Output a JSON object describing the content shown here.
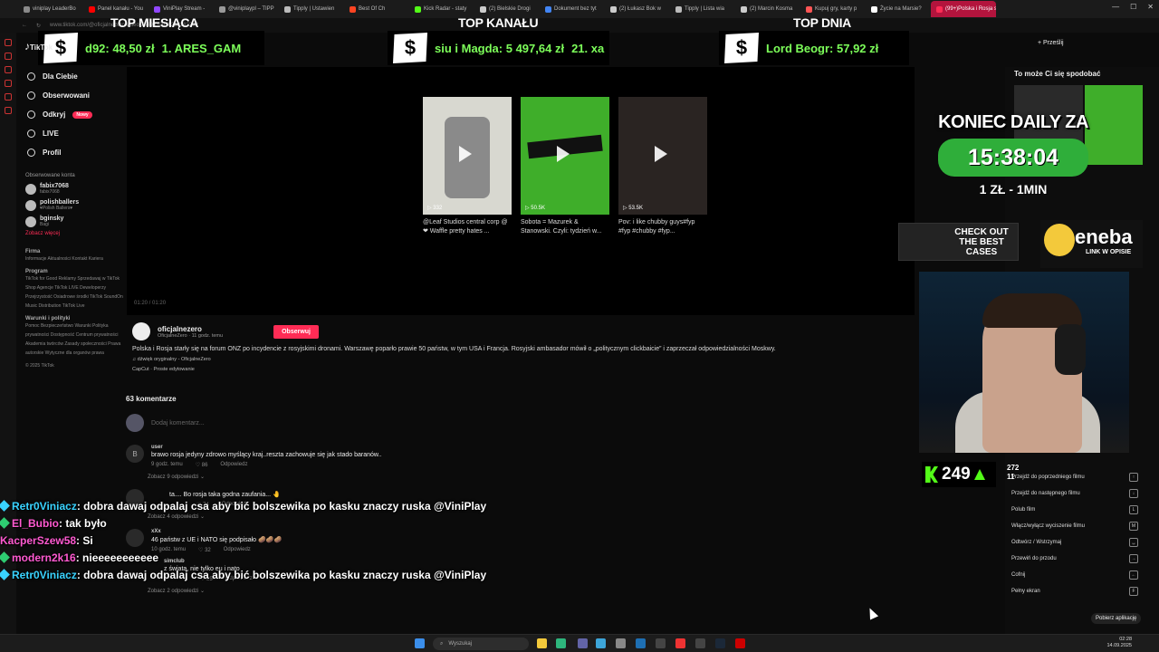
{
  "browser": {
    "tabs": [
      {
        "label": "viniplay LeaderBo",
        "color": "#8a8a8a"
      },
      {
        "label": "Panel kanału - You",
        "color": "#ff0000"
      },
      {
        "label": "ViniPlay Stream -",
        "color": "#9147ff"
      },
      {
        "label": "@viniplaypl – TIPP",
        "color": "#999999"
      },
      {
        "label": "Tipply | Ustawien",
        "color": "#bbbbbb"
      },
      {
        "label": "Best Of Ch",
        "color": "#ff4422"
      },
      {
        "label": "Kick Radar - staty",
        "color": "#53fc18"
      },
      {
        "label": "(2) Bielskie Drogi",
        "color": "#cccccc"
      },
      {
        "label": "Dokument bez tyt",
        "color": "#4285f4"
      },
      {
        "label": "(2) Łukasz Bok w",
        "color": "#cccccc"
      },
      {
        "label": "Tipply | Lista wia",
        "color": "#bbbbbb"
      },
      {
        "label": "(2) Marcin Kosma",
        "color": "#cccccc"
      },
      {
        "label": "Kupuj gry, karty p",
        "color": "#f55"
      },
      {
        "label": "Życie na Marsie?",
        "color": "#ffffff"
      },
      {
        "label": "(99+)Polska i Rosja starły",
        "color": "#fe2c55"
      }
    ],
    "url": "www.tiktok.com/@oficjalnezero/video/7549530976218282282"
  },
  "banners": [
    {
      "title": "TOP MIESIĄCA",
      "text": "d92: 48,50 zł",
      "text2": "1. ARES_GAM"
    },
    {
      "title": "TOP KANAŁU",
      "text": "siu i Magda: 5 497,64 zł",
      "text2": "21. xa"
    },
    {
      "title": "TOP DNIA",
      "text": "Lord Beogr: 57,92 zł",
      "text2": ""
    }
  ],
  "dollar": "$",
  "tiktok": {
    "logo": "TikTok",
    "nav": [
      "Dla Ciebie",
      "Obserwowani",
      "Odkryj",
      "LIVE",
      "Profil"
    ],
    "new_badge": "Nowy",
    "followed_header": "Obserwowane konta",
    "followed": [
      {
        "name": "fabix7068",
        "sub": "fabix7068"
      },
      {
        "name": "polishballers",
        "sub": "♥Polish Ballers♥"
      },
      {
        "name": "bginsky",
        "sub": "Bagi"
      }
    ],
    "see_more": "Zobacz więcej",
    "footer_company": "Firma",
    "footer_company_links": "Informacje  Aktualności  Kontakt  Kariera",
    "footer_program": "Program",
    "footer_program_links": "TikTok for Good  Reklamy  Sprzedawaj w TikTok Shop  Agencje TikTok LIVE  Deweloperzy  Przejrzystość  Osiadrowe środki TikTok  SoundOn Music Distribution  TikTok Live",
    "footer_terms": "Warunki i polityki",
    "footer_terms_links": "Pomoc  Bezpieczeństwo  Warunki  Polityka prywatności  Dostępność  Centrum prywatności  Akademia twórców  Zasady społeczności  Prawa autorskie  Wytyczne dla organów prawa",
    "copyright": "© 2025 TikTok"
  },
  "videos": [
    {
      "views": "▷ 332",
      "caption": "@Leaf Studios central corp @❤ Waffle pretty hates ...",
      "bg": "#d8d8d0"
    },
    {
      "views": "▷ 50.5K",
      "caption": "Sobota = Mazurek & Stanowski. Czyli: tydzień w...",
      "bg": "#3fae2a"
    },
    {
      "views": "▷ 53.5K",
      "caption": "Pov: i like chubby guys#fyp #fyp #chubby #fyp...",
      "bg": "#2a2422"
    }
  ],
  "time_display": "01:20 / 01:20",
  "post": {
    "author": "oficjalnezero",
    "author_sub": "OficjalneZero · 11 godz. temu",
    "follow": "Obserwuj",
    "description": "Polska i Rosja starły się na forum ONZ po incydencie z rosyjskimi dronami. Warszawę poparło prawie 50 państw, w tym USA i Francja. Rosyjski ambasador mówił o „politycznym clickbaicie” i zaprzeczał odpowiedzialności Moskwy.",
    "sound": "♫ dźwięk oryginalny - OficjalneZero",
    "capcut": "CapCut · Proste edytowanie"
  },
  "comments": {
    "count": "63 komentarze",
    "placeholder": "Dodaj komentarz...",
    "reply_label": "Odpowiedz",
    "items": [
      {
        "avatar": "B",
        "user": "user",
        "text": "brawo rosja jedyny zdrowo myślący kraj..reszta zachowuje się jak stado baranów..",
        "time": "9 godz. temu",
        "likes": "♡ 86",
        "more": "Zobacz 9 odpowiedzi ⌄"
      },
      {
        "avatar": "",
        "user": "",
        "text": "ta.... Bo rosja taka godna zaufania... 🤚",
        "time": "",
        "likes": "♡ 74",
        "more": "Zobacz 4 odpowiedzi ⌄"
      },
      {
        "avatar": "",
        "user": "xXx",
        "text": "46 państw z UE i NATO się podpisało 🥔🥔🥔",
        "time": "10 godz. temu",
        "likes": "♡ 32",
        "more": ""
      },
      {
        "avatar": "",
        "user": "simclub",
        "text": "z świata, nie tylko eu i nato",
        "time": "",
        "likes": "♡ 85",
        "more": "Zobacz 2 odpowiedzi ⌄"
      }
    ]
  },
  "chat": [
    {
      "user": "Retr0Viniacz",
      "color": "#39d3ff",
      "msg": ": dobra dawaj odpalaj csa aby bić bolszewika po kasku znaczy ruska @ViniPlay"
    },
    {
      "user": "El_Bubio",
      "color": "#ff5ad1",
      "msg": ": tak było"
    },
    {
      "user": "KacperSzew58",
      "color": "#ff5ad1",
      "msg": ": Si"
    },
    {
      "user": "modern2k16",
      "color": "#ff5ad1",
      "msg": ": nieeeeeeeeeee"
    },
    {
      "user": "Retr0Viniacz",
      "color": "#39d3ff",
      "msg": ": dobra dawaj odpalaj csa aby bić bolszewika po kasku znaczy ruska @ViniPlay"
    }
  ],
  "right": {
    "upload": "+ Prześlij",
    "suggest_title": "To może Ci się spodobać",
    "daily_title": "KONIEC DAILY ZA",
    "daily_timer": "15:38:04",
    "daily_sub": "1 ZŁ - 1MIN",
    "ad1": "CHECK OUT THE BEST CASES",
    "ad2": "eneba",
    "ad2_sub": "LINK W OPISIE",
    "counter": "249",
    "stats1": "272",
    "stats2": "11",
    "shortcuts": [
      {
        "label": "Przejdź do poprzedniego filmu",
        "key": "↑"
      },
      {
        "label": "Przejdź do następnego filmu",
        "key": "↓"
      },
      {
        "label": "Polub film",
        "key": "L"
      },
      {
        "label": "Włącz/wyłącz wyciszenie filmu",
        "key": "M"
      },
      {
        "label": "Odtwórz / Wstrzymaj",
        "key": "␣"
      },
      {
        "label": "Przewiń do przodu",
        "key": "→"
      },
      {
        "label": "Cofnij",
        "key": "←"
      },
      {
        "label": "Pełny ekran",
        "key": "F"
      }
    ],
    "get_app": "Pobierz aplikację"
  },
  "taskbar": {
    "search": "Wyszukaj",
    "time": "02:28",
    "date": "14.09.2025"
  }
}
